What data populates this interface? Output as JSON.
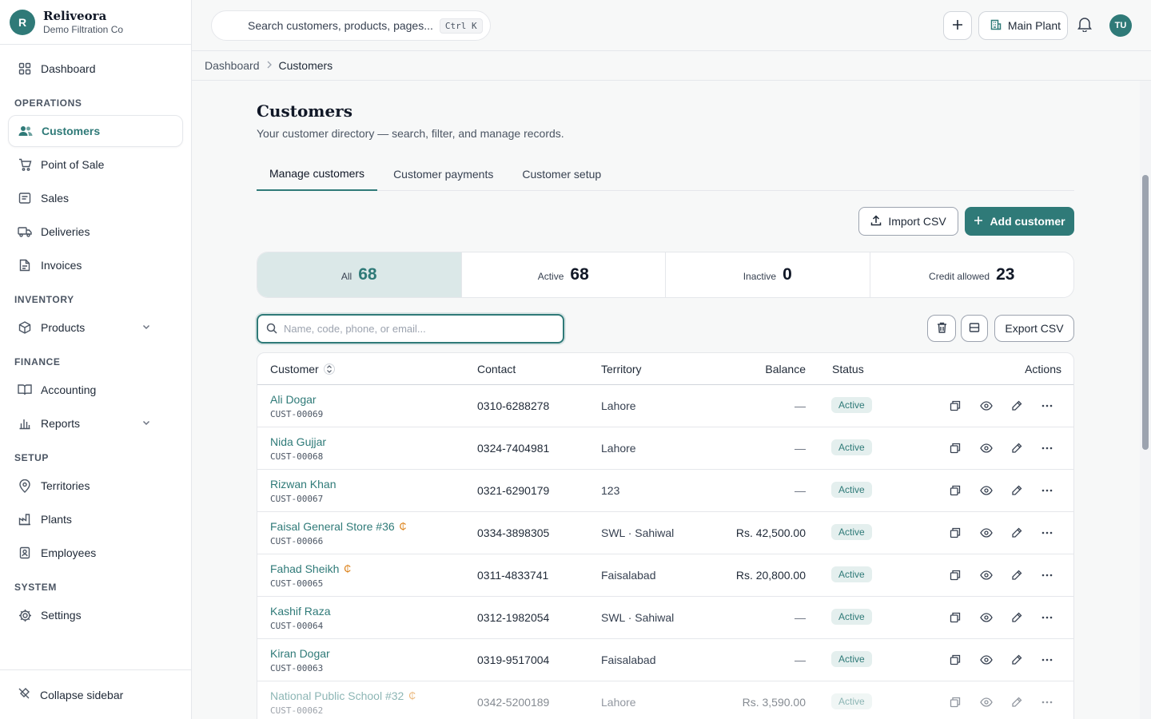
{
  "brand": {
    "initial": "R",
    "name": "Reliveora",
    "subtitle": "Demo Filtration Co"
  },
  "sidebar": {
    "dashboard": "Dashboard",
    "operations_title": "OPERATIONS",
    "operations": [
      "Customers",
      "Point of Sale",
      "Sales",
      "Deliveries",
      "Invoices"
    ],
    "inventory_title": "INVENTORY",
    "products": "Products",
    "finance_title": "FINANCE",
    "accounting": "Accounting",
    "reports": "Reports",
    "setup_title": "SETUP",
    "setup": [
      "Territories",
      "Plants",
      "Employees"
    ],
    "system_title": "SYSTEM",
    "settings": "Settings",
    "collapse": "Collapse sidebar"
  },
  "topbar": {
    "search_placeholder": "Search customers, products, pages...",
    "shortcut": "Ctrl K",
    "plant": "Main Plant",
    "avatar": "TU"
  },
  "breadcrumb": {
    "root": "Dashboard",
    "current": "Customers"
  },
  "page": {
    "title": "Customers",
    "subtitle": "Your customer directory — search, filter, and manage records.",
    "tabs": [
      "Manage customers",
      "Customer payments",
      "Customer setup"
    ],
    "import_label": "Import CSV",
    "add_label": "Add customer",
    "filter_placeholder": "Name, code, phone, or email...",
    "export_label": "Export CSV"
  },
  "stats": [
    {
      "label": "All",
      "value": "68"
    },
    {
      "label": "Active",
      "value": "68"
    },
    {
      "label": "Inactive",
      "value": "0"
    },
    {
      "label": "Credit allowed",
      "value": "23"
    }
  ],
  "table": {
    "headers": {
      "customer": "Customer",
      "contact": "Contact",
      "territory": "Territory",
      "balance": "Balance",
      "status": "Status",
      "actions": "Actions"
    },
    "rows": [
      {
        "name": "Ali Dogar",
        "code": "CUST-00069",
        "contact": "0310-6288278",
        "territory": "Lahore",
        "balance": "—",
        "status": "Active",
        "credit": ""
      },
      {
        "name": "Nida Gujjar",
        "code": "CUST-00068",
        "contact": "0324-7404981",
        "territory": "Lahore",
        "balance": "—",
        "status": "Active",
        "credit": ""
      },
      {
        "name": "Rizwan Khan",
        "code": "CUST-00067",
        "contact": "0321-6290179",
        "territory": "123",
        "balance": "—",
        "status": "Active",
        "credit": ""
      },
      {
        "name": "Faisal General Store #36",
        "code": "CUST-00066",
        "contact": "0334-3898305",
        "territory": "SWL · Sahiwal",
        "balance": "Rs. 42,500.00",
        "status": "Active",
        "credit": "₵"
      },
      {
        "name": "Fahad Sheikh",
        "code": "CUST-00065",
        "contact": "0311-4833741",
        "territory": "Faisalabad",
        "balance": "Rs. 20,800.00",
        "status": "Active",
        "credit": "₵"
      },
      {
        "name": "Kashif Raza",
        "code": "CUST-00064",
        "contact": "0312-1982054",
        "territory": "SWL · Sahiwal",
        "balance": "—",
        "status": "Active",
        "credit": ""
      },
      {
        "name": "Kiran Dogar",
        "code": "CUST-00063",
        "contact": "0319-9517004",
        "territory": "Faisalabad",
        "balance": "—",
        "status": "Active",
        "credit": ""
      },
      {
        "name": "National Public School #32",
        "code": "CUST-00062",
        "contact": "0342-5200189",
        "territory": "Lahore",
        "balance": "Rs. 3,590.00",
        "status": "Active",
        "credit": "₵"
      }
    ]
  }
}
